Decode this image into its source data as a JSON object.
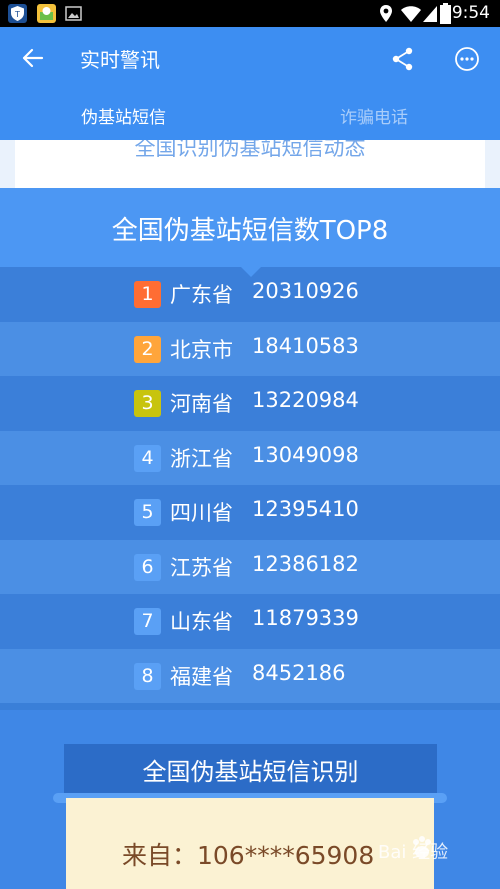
{
  "status_bar": {
    "time": "9:54"
  },
  "app_bar": {
    "title": "实时警讯"
  },
  "tabs": [
    {
      "label": "伪基站短信"
    },
    {
      "label": "诈骗电话"
    }
  ],
  "banner": {
    "text": "全国识别伪基站短信动态"
  },
  "top8": {
    "title": "全国伪基站短信数TOP8",
    "rows": [
      {
        "rank": "1",
        "province": "广东省",
        "count": "20310926",
        "badge_color": "#ff6d33"
      },
      {
        "rank": "2",
        "province": "北京市",
        "count": "18410583",
        "badge_color": "#ffa53b"
      },
      {
        "rank": "3",
        "province": "河南省",
        "count": "13220984",
        "badge_color": "#c8c40e"
      },
      {
        "rank": "4",
        "province": "浙江省",
        "count": "13049098",
        "badge_color": "#5aa0f5"
      },
      {
        "rank": "5",
        "province": "四川省",
        "count": "12395410",
        "badge_color": "#5aa0f5"
      },
      {
        "rank": "6",
        "province": "江苏省",
        "count": "12386182",
        "badge_color": "#5aa0f5"
      },
      {
        "rank": "7",
        "province": "山东省",
        "count": "11879339",
        "badge_color": "#5aa0f5"
      },
      {
        "rank": "8",
        "province": "福建省",
        "count": "8452186",
        "badge_color": "#5aa0f5"
      }
    ]
  },
  "recognition": {
    "title": "全国伪基站短信识别",
    "from_text": "来自：106****65908"
  },
  "watermark": {
    "text": "Bai 经验"
  },
  "colors": {
    "primary": "#3d8ef2",
    "list_odd": "#3b7fd9",
    "list_even": "#4b8fe4",
    "paper": "#fbf2d3"
  }
}
